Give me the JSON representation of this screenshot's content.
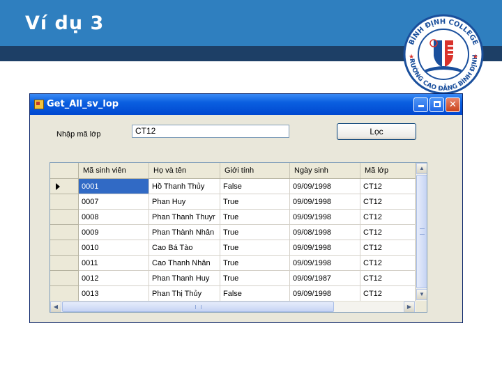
{
  "slide": {
    "title": "Ví dụ 3"
  },
  "logo": {
    "top_text": "BÌNH ĐỊNH COLLEGE",
    "bottom_text": "TRƯỜNG CAO ĐẲNG BÌNH ĐỊNH",
    "colors": {
      "ring": "#1a4f9c",
      "accent": "#d9322b",
      "book": "#1a4f9c"
    }
  },
  "window": {
    "title": "Get_All_sv_lop",
    "controls": {
      "minimize": "minimize",
      "maximize": "maximize",
      "close": "✕"
    }
  },
  "filter": {
    "label": "Nhập mã lớp",
    "input_value": "CT12",
    "button_label": "Lọc"
  },
  "grid": {
    "columns": [
      "Mã sinh viên",
      "Họ và tên",
      "Giới tính",
      "Ngày sinh",
      "Mã lớp"
    ],
    "selected_row": 0,
    "rows": [
      [
        "0001",
        "Hồ Thanh Thủy",
        "False",
        "09/09/1998",
        "CT12"
      ],
      [
        "0007",
        "Phan Huy",
        "True",
        "09/09/1998",
        "CT12"
      ],
      [
        "0008",
        "Phan Thanh Thuyr",
        "True",
        "09/09/1998",
        "CT12"
      ],
      [
        "0009",
        "Phan Thành Nhân",
        "True",
        "09/08/1998",
        "CT12"
      ],
      [
        "0010",
        "Cao Bá Tào",
        "True",
        "09/09/1998",
        "CT12"
      ],
      [
        "0011",
        "Cao Thanh Nhân",
        "True",
        "09/09/1998",
        "CT12"
      ],
      [
        "0012",
        "Phan Thanh Huy",
        "True",
        "09/09/1987",
        "CT12"
      ],
      [
        "0013",
        "Phan Thị Thủy",
        "False",
        "09/09/1998",
        "CT12"
      ]
    ]
  },
  "colors": {
    "header_blue": "#2f7fbf",
    "band_navy": "#1d3f66",
    "selection": "#316ac5"
  }
}
